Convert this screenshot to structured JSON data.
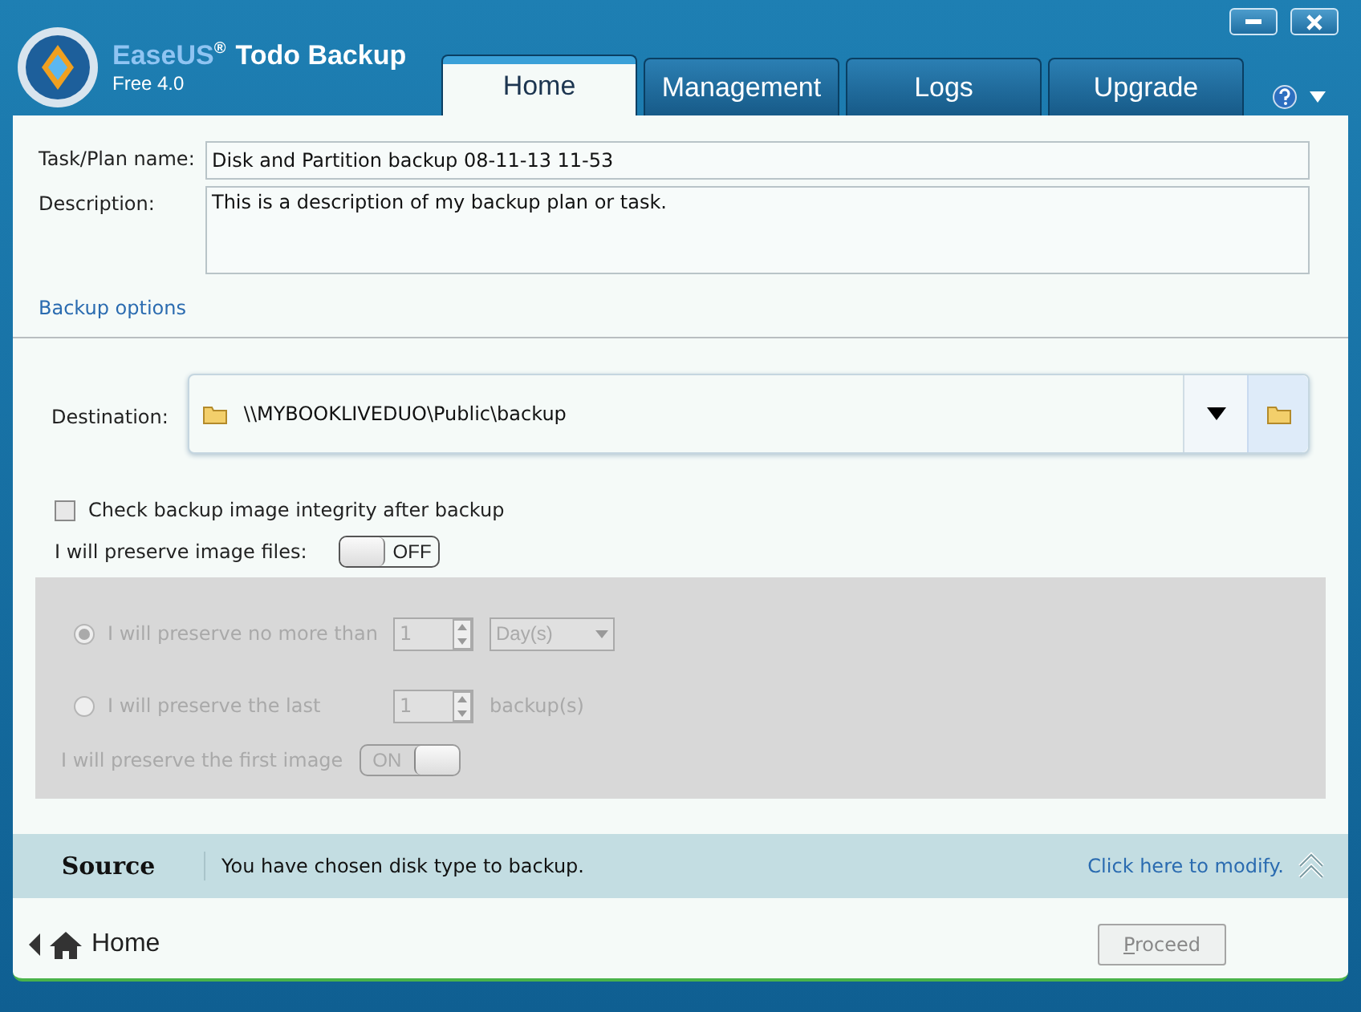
{
  "app": {
    "brand_a": "EaseUS",
    "brand_b": "Todo Backup",
    "registered": "®",
    "edition": "Free 4.0"
  },
  "tabs": [
    {
      "label": "Home",
      "selected": true
    },
    {
      "label": "Management",
      "selected": false
    },
    {
      "label": "Logs",
      "selected": false
    },
    {
      "label": "Upgrade",
      "selected": false
    }
  ],
  "form": {
    "task_label": "Task/Plan name:",
    "task_value": "Disk and Partition backup 08-11-13 11-53",
    "description_label": "Description:",
    "description_value": "This is a description of my backup plan or task.",
    "options_link": "Backup options"
  },
  "destination": {
    "label": "Destination:",
    "value": "\\\\MYBOOKLIVEDUO\\Public\\backup"
  },
  "integrity_check": {
    "label": "Check backup image integrity after backup",
    "checked": false
  },
  "preserve": {
    "label": "I will preserve image files:",
    "toggle_text": "OFF",
    "on": false
  },
  "retention": {
    "disabled": true,
    "options": [
      {
        "kind": "dropdown",
        "label": "I will preserve no more than",
        "selected": true,
        "value": "1",
        "unit": "Day(s)"
      },
      {
        "kind": "text",
        "label": "I will preserve the last",
        "selected": false,
        "value": "1",
        "unit": "backup(s)"
      }
    ],
    "first_image": {
      "label": "I will preserve the first image",
      "toggle_text": "ON",
      "on": true
    }
  },
  "source": {
    "title": "Source",
    "message": "You have chosen disk type to backup.",
    "link": "Click here to modify."
  },
  "footer": {
    "back_label": "Home",
    "proceed": {
      "label": "Proceed",
      "disabled": true
    }
  }
}
